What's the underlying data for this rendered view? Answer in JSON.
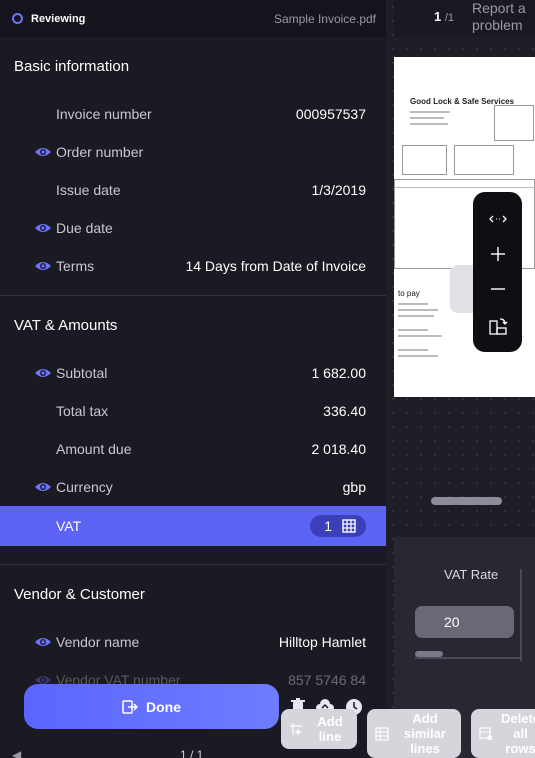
{
  "header": {
    "status": "Reviewing",
    "filename": "Sample Invoice.pdf"
  },
  "viewer": {
    "page": "1",
    "page_total": "/1",
    "report_label": "Report a problem",
    "doc": {
      "company": "Good Lock & Safe Services",
      "to_pay": "to pay"
    }
  },
  "sections": {
    "basic": {
      "title": "Basic information",
      "fields": [
        {
          "label": "Invoice number",
          "value": "000957537",
          "eye": false
        },
        {
          "label": "Order number",
          "value": "",
          "eye": true
        },
        {
          "label": "Issue date",
          "value": "1/3/2019",
          "eye": false
        },
        {
          "label": "Due date",
          "value": "",
          "eye": true
        },
        {
          "label": "Terms",
          "value": "14 Days from Date of Invoice",
          "eye": true
        }
      ]
    },
    "vat": {
      "title": "VAT & Amounts",
      "fields": [
        {
          "label": "Subtotal",
          "value": "1 682.00",
          "eye": true
        },
        {
          "label": "Total tax",
          "value": "336.40",
          "eye": false
        },
        {
          "label": "Amount due",
          "value": "2 018.40",
          "eye": false
        },
        {
          "label": "Currency",
          "value": "gbp",
          "eye": true
        }
      ],
      "active_row": {
        "label": "VAT",
        "count": "1"
      }
    },
    "vendor": {
      "title": "Vendor & Customer",
      "fields": [
        {
          "label": "Vendor name",
          "value": "Hilltop Hamlet",
          "eye": true
        },
        {
          "label": "Vendor VAT number",
          "value": "857 5746 84",
          "eye": true
        }
      ]
    }
  },
  "footer": {
    "done_label": "Done",
    "pager": "1 / 1",
    "pager_left": "◀"
  },
  "vat_panel": {
    "column_label": "VAT Rate",
    "rate_value": "20"
  },
  "actions": {
    "add_line": "Add line",
    "add_similar": "Add similar lines",
    "delete_all": "Delete all rows"
  },
  "colors": {
    "accent": "#5c63f5",
    "background": "#1b1922"
  }
}
